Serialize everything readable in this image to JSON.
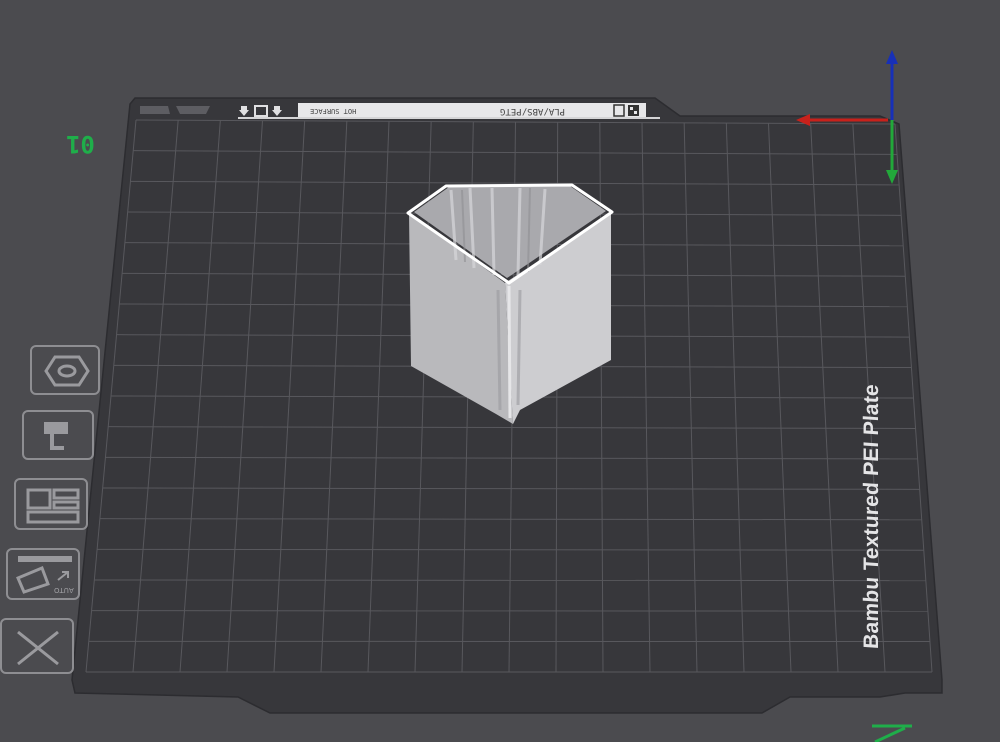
{
  "plate": {
    "name": "Bambu Textured PEI Plate",
    "number": "01",
    "strip_filament": "PLA/ABS/PETG",
    "strip_mode": "HOT SURFACE"
  },
  "toolbar": {
    "items": [
      {
        "name": "arrange",
        "icon": "hexagon-nut-icon"
      },
      {
        "name": "orient",
        "icon": "plate-stand-icon"
      },
      {
        "name": "layout",
        "icon": "grid-layout-icon"
      },
      {
        "name": "auto-orient",
        "icon": "auto-orient-icon",
        "label": "AUTO"
      },
      {
        "name": "remove",
        "icon": "close-icon"
      }
    ]
  },
  "axes": {
    "x_color": "#c8211b",
    "y_color": "#22a83a",
    "z_color": "#1730b8"
  },
  "colors": {
    "plate": "#37373b",
    "grid": "#5a5a5f",
    "model": "#cfcfd2",
    "background": "#4b4b4f"
  }
}
